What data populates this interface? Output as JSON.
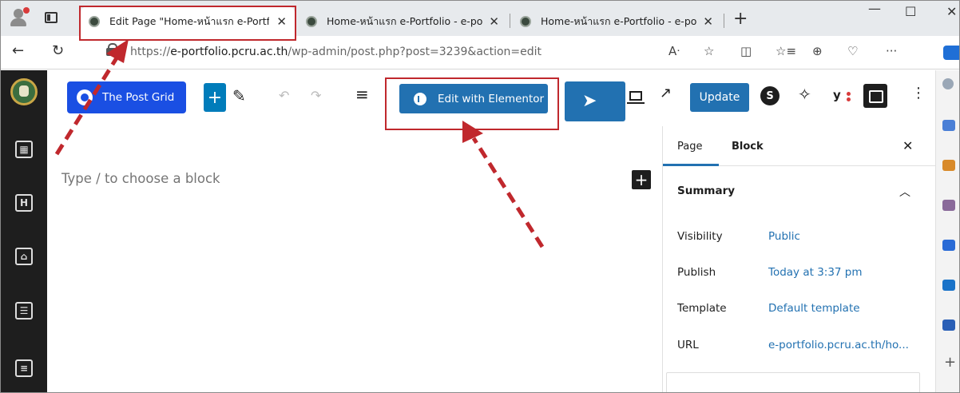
{
  "browser": {
    "tabs": [
      {
        "title": "Edit Page \"Home-หน้าแรก e-Portf"
      },
      {
        "title": "Home-หน้าแรก e-Portfolio - e-po"
      },
      {
        "title": "Home-หน้าแรก e-Portfolio - e-po"
      }
    ],
    "url_prefix": "https://",
    "url_host": "e-portfolio.pcru.ac.th",
    "url_path": "/wp-admin/post.php?post=3239&action=edit"
  },
  "toolbar": {
    "post_grid_label": "The Post Grid",
    "elementor_label": "Edit with Elementor",
    "update_label": "Update"
  },
  "canvas": {
    "placeholder": "Type / to choose a block"
  },
  "panel": {
    "tab_page": "Page",
    "tab_block": "Block",
    "summary_label": "Summary",
    "rows": [
      {
        "label": "Visibility",
        "value": "Public"
      },
      {
        "label": "Publish",
        "value": "Today at 3:37 pm"
      },
      {
        "label": "Template",
        "value": "Default template"
      },
      {
        "label": "URL",
        "value": "e-portfolio.pcru.ac.th/ho..."
      }
    ]
  },
  "colors": {
    "accent": "#2271b1",
    "post_grid": "#1a4fe3",
    "annotation": "#c0282d",
    "wp_sidebar": "#1e1e1e"
  }
}
